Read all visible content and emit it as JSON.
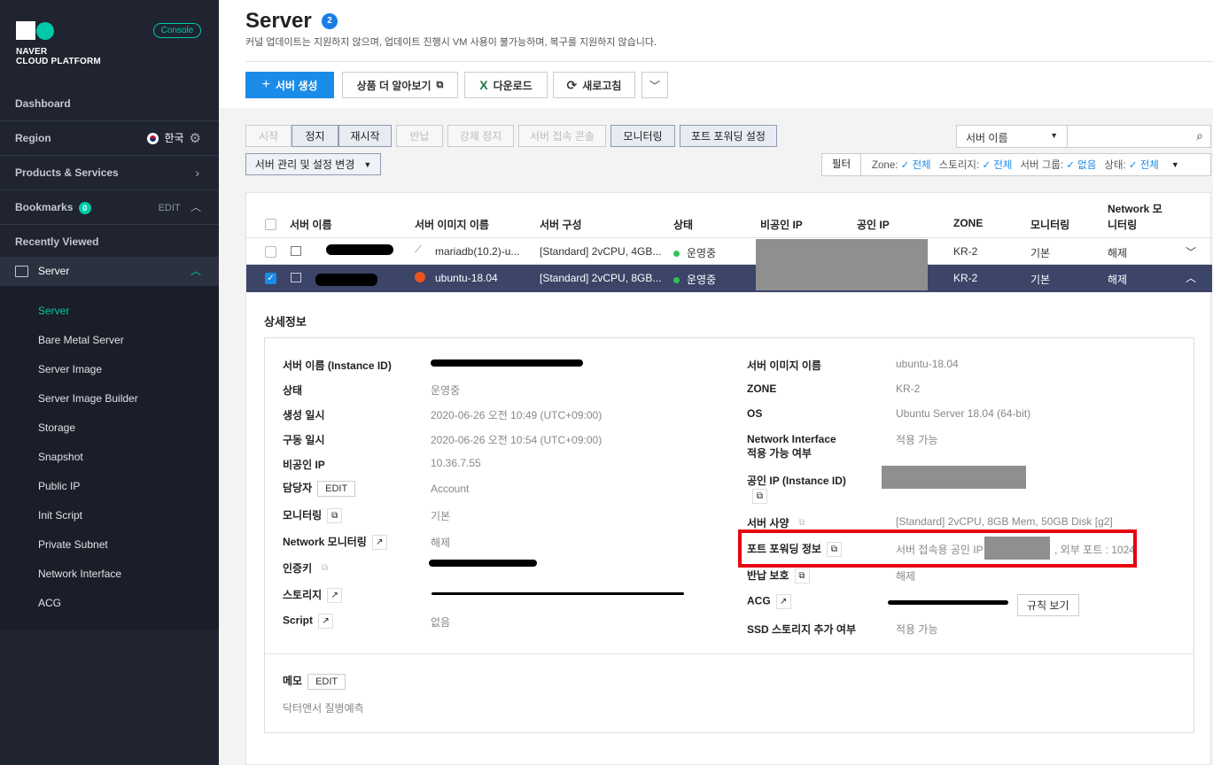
{
  "sidebar": {
    "logo_line1": "NAVER",
    "logo_line2": "CLOUD PLATFORM",
    "console": "Console",
    "dashboard": "Dashboard",
    "region": "Region",
    "region_value": "한국",
    "products": "Products & Services",
    "bookmarks": "Bookmarks",
    "bookmarks_count": "0",
    "bookmarks_edit": "EDIT",
    "recent": "Recently Viewed",
    "server": "Server",
    "items": [
      "Server",
      "Bare Metal Server",
      "Server Image",
      "Server Image Builder",
      "Storage",
      "Snapshot",
      "Public IP",
      "Init Script",
      "Private Subnet",
      "Network Interface",
      "ACG"
    ]
  },
  "header": {
    "title": "Server",
    "count": "2",
    "subtitle": "커널 업데이트는 지원하지 않으며, 업데이트 진행시 VM 사용이 불가능하며, 복구를 지원하지 않습니다."
  },
  "toolbar": {
    "create": "서버 생성",
    "learn_more": "상품 더 알아보기",
    "download": "다운로드",
    "refresh": "새로고침"
  },
  "actions": {
    "start": "시작",
    "stop": "정지",
    "restart": "재시작",
    "return": "반납",
    "force_stop": "강제 정지",
    "console": "서버 접속 콘솔",
    "monitoring": "모니터링",
    "port_forward": "포트 포워딩 설정",
    "manage": "서버 관리 및 설정 변경"
  },
  "search": {
    "select": "서버 이름",
    "placeholder": ""
  },
  "filter": {
    "label": "필터",
    "zone_label": "Zone:",
    "zone_value": "전체",
    "storage_label": "스토리지:",
    "storage_value": "전체",
    "group_label": "서버 그룹:",
    "group_value": "없음",
    "status_label": "상태:",
    "status_value": "전체"
  },
  "table": {
    "headers": [
      "서버 이름",
      "서버 이미지 이름",
      "서버 구성",
      "상태",
      "비공인 IP",
      "공인 IP",
      "ZONE",
      "모니터링",
      "Network 모",
      "니터링"
    ],
    "rows": [
      {
        "image": "mariadb(10.2)-u...",
        "spec": "[Standard] 2vCPU, 4GB...",
        "status": "운영중",
        "zone": "KR-2",
        "monitoring": "기본",
        "network": "해제"
      },
      {
        "image": "ubuntu-18.04",
        "spec": "[Standard] 2vCPU, 8GB...",
        "status": "운영중",
        "zone": "KR-2",
        "monitoring": "기본",
        "network": "해제"
      }
    ]
  },
  "detail": {
    "title": "상세정보",
    "left": [
      {
        "label": "서버 이름 (Instance ID)",
        "value": ""
      },
      {
        "label": "상태",
        "value": "운영중"
      },
      {
        "label": "생성 일시",
        "value": "2020-06-26 오전 10:49 (UTC+09:00)"
      },
      {
        "label": "구동 일시",
        "value": "2020-06-26 오전 10:54 (UTC+09:00)"
      },
      {
        "label": "비공인 IP",
        "value": "10.36.7.55"
      },
      {
        "label": "담당자",
        "value": "Account"
      },
      {
        "label": "모니터링",
        "value": "기본"
      },
      {
        "label": "Network 모니터링",
        "value": "해제"
      },
      {
        "label": "인증키",
        "value": ""
      },
      {
        "label": "스토리지",
        "value": ""
      },
      {
        "label": "Script",
        "value": "없음"
      }
    ],
    "right": [
      {
        "label": "서버 이미지 이름",
        "value": "ubuntu-18.04"
      },
      {
        "label": "ZONE",
        "value": "KR-2"
      },
      {
        "label": "OS",
        "value": "Ubuntu Server 18.04 (64-bit)"
      },
      {
        "label": "Network Interface",
        "label2": "적용 가능 여부",
        "value": "적용 가능"
      },
      {
        "label": "공인 IP (Instance ID)",
        "value": ""
      },
      {
        "label": "서버 사양",
        "value": "[Standard] 2vCPU, 8GB Mem, 50GB Disk [g2]"
      },
      {
        "label": "포트 포워딩 정보",
        "value": "서버 접속용 공인 IP :",
        "value2": ", 외부 포트 : 1024"
      },
      {
        "label": "반납 보호",
        "value": "해제"
      },
      {
        "label": "ACG",
        "value": "",
        "button": "규칙 보기"
      },
      {
        "label": "SSD 스토리지 추가 여부",
        "value": "적용 가능"
      }
    ],
    "edit": "EDIT",
    "memo_label": "메모",
    "memo_value": "닥터앤서 질병예측"
  }
}
